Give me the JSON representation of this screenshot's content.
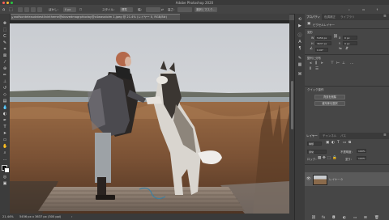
{
  "window": {
    "title": "Adobe Photoshop 2020",
    "traffic_lights": [
      "#ff5f57",
      "#febc2e",
      "#28c840"
    ]
  },
  "options_bar": {
    "home_icon": "home-icon",
    "tool_icon": "move-marquee-icon",
    "mode_label": "モード：",
    "mode_value": "通常",
    "feather_label": "ぼかし：",
    "feather_value": "0 px",
    "style_label": "スタイル：",
    "style_value": "標準",
    "width_label": "幅：",
    "height_label": "高さ：",
    "select_mask_button": "選択とマスク..."
  },
  "document": {
    "tab_title": "wolfsonteleaudatest4nintheme@skavedmagrphioday@x4wavalolm 1.jpeg @ 21.4% (レイヤー 0, RGB/8#)",
    "close_symbol": "×"
  },
  "status_bar": {
    "zoom": "21.44%",
    "doc_info": "5456 px x 3637 px (300 ppi)",
    "arrow": "›"
  },
  "properties_panel": {
    "tabs": [
      "プロパティ",
      "色調補正",
      "ライブラリ"
    ],
    "active_tab": 0,
    "pixel_layer_label": "ピクセルレイヤー",
    "transform_label": "変形",
    "w_label": "W",
    "w_value": "5456 px",
    "h_label": "H",
    "h_value": "3637 px",
    "x_label": "X",
    "x_value": "0 px",
    "y_label": "Y",
    "y_value": "0 px",
    "angle_value": "0.00°",
    "align_label": "整列と分布",
    "quick_actions_label": "クイック操作",
    "remove_bg_button": "背景を削除",
    "select_subject_button": "被写体を選択"
  },
  "layers_panel": {
    "tabs": [
      "レイヤー",
      "チャンネル",
      "パス"
    ],
    "active_tab": 0,
    "filter_kind": "種類",
    "blend_mode": "通常",
    "opacity_label": "不透明度：",
    "opacity_value": "100%",
    "lock_label": "ロック：",
    "fill_label": "塗り：",
    "fill_value": "100%",
    "layer_name": "レイヤー 0"
  },
  "top_right": {
    "search_icon": "search-icon",
    "workspace_icon": "workspace-icon",
    "share_icon": "share-icon"
  }
}
